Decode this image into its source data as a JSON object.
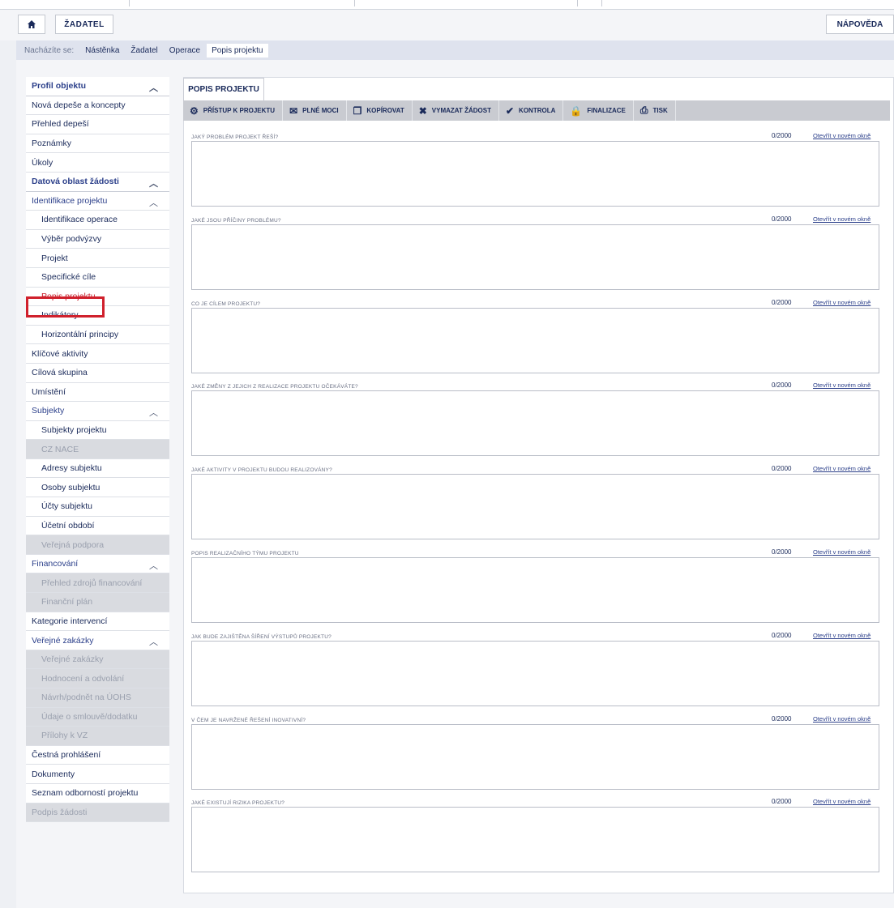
{
  "header": {
    "home_icon": "home-icon",
    "zadatel_label": "ŽADATEL",
    "help_label": "NÁPOVĚDA"
  },
  "breadcrumb": [
    "Nacházíte se:",
    "Nástěnka",
    "Žadatel",
    "Operace",
    "Popis projektu"
  ],
  "sidebar": [
    {
      "label": "Profil objektu",
      "type": "section",
      "caret": true
    },
    {
      "label": "Nová depeše a koncepty",
      "type": "item"
    },
    {
      "label": "Přehled depeší",
      "type": "item"
    },
    {
      "label": "Poznámky",
      "type": "item"
    },
    {
      "label": "Úkoly",
      "type": "item"
    },
    {
      "label": "Datová oblast žádosti",
      "type": "section",
      "caret": true
    },
    {
      "label": "Identifikace projektu",
      "type": "link",
      "caret": true
    },
    {
      "label": "Identifikace operace",
      "type": "sub"
    },
    {
      "label": "Výběr podvýzvy",
      "type": "sub"
    },
    {
      "label": "Projekt",
      "type": "sub"
    },
    {
      "label": "Specifické cíle",
      "type": "sub"
    },
    {
      "label": "Popis projektu",
      "type": "sub",
      "active": true
    },
    {
      "label": "Indikátory",
      "type": "sub"
    },
    {
      "label": "Horizontální principy",
      "type": "sub"
    },
    {
      "label": "Klíčové aktivity",
      "type": "item"
    },
    {
      "label": "Cílová skupina",
      "type": "item"
    },
    {
      "label": "Umístění",
      "type": "item"
    },
    {
      "label": "Subjekty",
      "type": "link",
      "caret": true
    },
    {
      "label": "Subjekty projektu",
      "type": "sub"
    },
    {
      "label": "CZ NACE",
      "type": "sub",
      "disabled": true
    },
    {
      "label": "Adresy subjektu",
      "type": "sub"
    },
    {
      "label": "Osoby subjektu",
      "type": "sub"
    },
    {
      "label": "Účty subjektu",
      "type": "sub"
    },
    {
      "label": "Účetní období",
      "type": "sub"
    },
    {
      "label": "Veřejná podpora",
      "type": "sub",
      "disabled": true
    },
    {
      "label": "Financování",
      "type": "link",
      "caret": true
    },
    {
      "label": "Přehled zdrojů financování",
      "type": "sub",
      "disabled": true
    },
    {
      "label": "Finanční plán",
      "type": "sub",
      "disabled": true
    },
    {
      "label": "Kategorie intervencí",
      "type": "item"
    },
    {
      "label": "Veřejné zakázky",
      "type": "link",
      "caret": true
    },
    {
      "label": "Veřejné zakázky",
      "type": "sub",
      "disabled": true
    },
    {
      "label": "Hodnocení a odvolání",
      "type": "sub",
      "disabled": true
    },
    {
      "label": "Návrh/podnět na ÚOHS",
      "type": "sub",
      "disabled": true
    },
    {
      "label": "Údaje o smlouvě/dodatku",
      "type": "sub",
      "disabled": true
    },
    {
      "label": "Přílohy k VZ",
      "type": "sub",
      "disabled": true
    },
    {
      "label": "Čestná prohlášení",
      "type": "item"
    },
    {
      "label": "Dokumenty",
      "type": "item"
    },
    {
      "label": "Seznam odborností projektu",
      "type": "item"
    },
    {
      "label": "Podpis žádosti",
      "type": "item",
      "disabled": true
    }
  ],
  "tab_label": "POPIS PROJEKTU",
  "toolbar": [
    {
      "icon": "users-icon",
      "glyph": "⚙",
      "label": "PŘÍSTUP K PROJEKTU"
    },
    {
      "icon": "mail-icon",
      "glyph": "✉",
      "label": "PLNÉ MOCI"
    },
    {
      "icon": "copy-icon",
      "glyph": "❐",
      "label": "KOPÍROVAT"
    },
    {
      "icon": "delete-icon",
      "glyph": "✖",
      "label": "VYMAZAT ŽÁDOST"
    },
    {
      "icon": "check-icon",
      "glyph": "✔",
      "label": "KONTROLA"
    },
    {
      "icon": "lock-icon",
      "glyph": "🔒",
      "label": "FINALIZACE"
    },
    {
      "icon": "print-icon",
      "glyph": "⎙",
      "label": "TISK"
    }
  ],
  "fields": [
    {
      "label": "JAKÝ PROBLÉM PROJEKT ŘEŠÍ?",
      "count": "0/2000",
      "link": "Otevřít v novém okně"
    },
    {
      "label": "JAKÉ JSOU PŘÍČINY PROBLÉMU?",
      "count": "0/2000",
      "link": "Otevřít v novém okně"
    },
    {
      "label": "CO JE CÍLEM PROJEKTU?",
      "count": "0/2000",
      "link": "Otevřít v novém okně"
    },
    {
      "label": "JAKÉ ZMĚNY Z JEJICH Z REALIZACE PROJEKTU OČEKÁVÁTE?",
      "count": "0/2000",
      "link": "Otevřít v novém okně"
    },
    {
      "label": "JAKÉ AKTIVITY V PROJEKTU BUDOU REALIZOVÁNY?",
      "count": "0/2000",
      "link": "Otevřít v novém okně"
    },
    {
      "label": "POPIS REALIZAČNÍHO TÝMU PROJEKTU",
      "count": "0/2000",
      "link": "Otevřít v novém okně"
    },
    {
      "label": "JAK BUDE ZAJIŠTĚNA ŠÍŘENÍ VÝSTUPŮ PROJEKTU?",
      "count": "0/2000",
      "link": "Otevřít v novém okně"
    },
    {
      "label": "V ČEM JE NAVRŽENÉ ŘEŠENÍ INOVATIVNÍ?",
      "count": "0/2000",
      "link": "Otevřít v novém okně"
    },
    {
      "label": "JAKÉ EXISTUJÍ RIZIKA PROJEKTU?",
      "count": "0/2000",
      "link": "Otevřít v novém okně"
    }
  ]
}
